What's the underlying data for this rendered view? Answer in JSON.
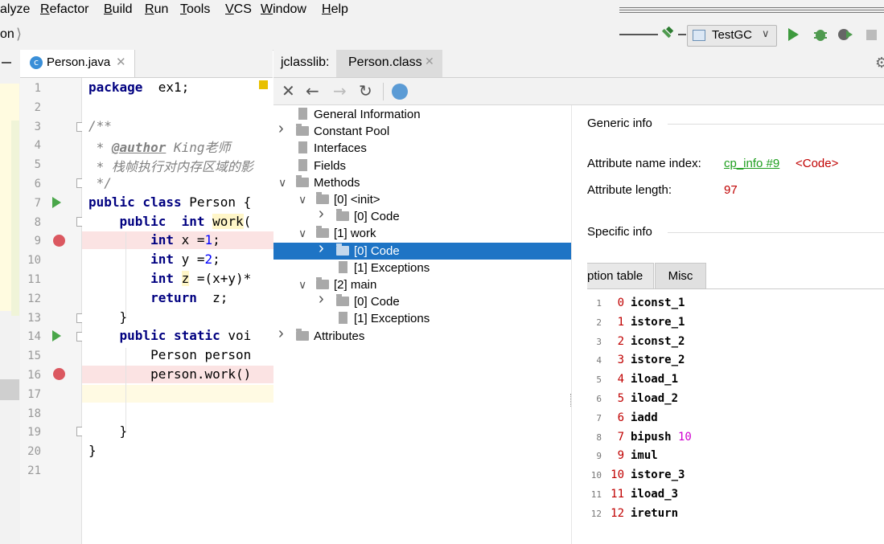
{
  "menu": {
    "items": [
      "alyze",
      "Refactor",
      "Build",
      "Run",
      "Tools",
      "VCS",
      "Window",
      "Help"
    ]
  },
  "navbar": {
    "breadcrumb": "on",
    "run_config": "TestGC"
  },
  "editor": {
    "tab_label": "Person.java",
    "line_numbers": [
      "1",
      "2",
      "3",
      "4",
      "5",
      "6",
      "7",
      "8",
      "9",
      "10",
      "11",
      "12",
      "13",
      "14",
      "15",
      "16",
      "17",
      "18",
      "19",
      "20",
      "21"
    ],
    "lines": [
      {
        "kw": "package",
        "rest": " ex1;"
      },
      {
        "kw": "",
        "rest": ""
      },
      {
        "kw": "",
        "rest": "/**"
      },
      {
        "kw": "",
        "rest": " * ",
        "tag": "@author",
        "tail": " King老师"
      },
      {
        "kw": "",
        "rest": " * 栈帧执行对内存区域的影"
      },
      {
        "kw": "",
        "rest": " */"
      },
      {
        "kw": "public class",
        "rest": " Person {"
      },
      {
        "kw": "    public",
        "kw2": "  int",
        "rest2": " work("
      },
      {
        "kw": "        int",
        "rest": " x =",
        "num": "1",
        ";": ";"
      },
      {
        "kw": "        int",
        "rest": " y =",
        "num": "2",
        ";": ";"
      },
      {
        "kw": "        int",
        "rest": " z =(x+y)*"
      },
      {
        "kw": "        return",
        "rest": "  z;"
      },
      {
        "kw": "",
        "rest": "    }"
      },
      {
        "kw": "    public static",
        "rest": " voi"
      },
      {
        "kw": "",
        "rest": "        Person person"
      },
      {
        "kw": "",
        "rest": "        person.work()"
      },
      {
        "kw": "",
        "rest": ""
      },
      {
        "kw": "",
        "rest": ""
      },
      {
        "kw": "",
        "rest": "    }"
      },
      {
        "kw": "",
        "rest": "}"
      },
      {
        "kw": "",
        "rest": ""
      }
    ]
  },
  "jclasslib": {
    "prefix": "jclasslib:",
    "tab_label": "Person.class",
    "tree": [
      {
        "label": "General Information",
        "indent": 0,
        "kind": "file",
        "chev": ""
      },
      {
        "label": "Constant Pool",
        "indent": 0,
        "kind": "folder",
        "chev": ">"
      },
      {
        "label": "Interfaces",
        "indent": 0,
        "kind": "file",
        "chev": ""
      },
      {
        "label": "Fields",
        "indent": 0,
        "kind": "file",
        "chev": ""
      },
      {
        "label": "Methods",
        "indent": 0,
        "kind": "folder",
        "chev": "v"
      },
      {
        "label": "[0] <init>",
        "indent": 1,
        "kind": "folder",
        "chev": "v"
      },
      {
        "label": "[0] Code",
        "indent": 2,
        "kind": "folder",
        "chev": ">"
      },
      {
        "label": "[1] work",
        "indent": 1,
        "kind": "folder",
        "chev": "v"
      },
      {
        "label": "[0] Code",
        "indent": 2,
        "kind": "folder",
        "chev": ">",
        "selected": true
      },
      {
        "label": "[1] Exceptions",
        "indent": 2,
        "kind": "file",
        "chev": ""
      },
      {
        "label": "[2] main",
        "indent": 1,
        "kind": "folder",
        "chev": "v"
      },
      {
        "label": "[0] Code",
        "indent": 2,
        "kind": "folder",
        "chev": ">"
      },
      {
        "label": "[1] Exceptions",
        "indent": 2,
        "kind": "file",
        "chev": ""
      },
      {
        "label": "Attributes",
        "indent": 0,
        "kind": "folder",
        "chev": ">"
      }
    ],
    "generic_info_title": "Generic info",
    "attr_name_index_label": "Attribute name index:",
    "attr_name_index_link": "cp_info #9",
    "attr_name_index_value": "<Code>",
    "attr_length_label": "Attribute length:",
    "attr_length_value": "97",
    "specific_info_title": "Specific info",
    "bytecode_tabs": [
      "ption table",
      "Misc"
    ],
    "bytecode": [
      {
        "ln": "1",
        "off": "0",
        "op": "iconst_1",
        "arg": ""
      },
      {
        "ln": "2",
        "off": "1",
        "op": "istore_1",
        "arg": ""
      },
      {
        "ln": "3",
        "off": "2",
        "op": "iconst_2",
        "arg": ""
      },
      {
        "ln": "4",
        "off": "3",
        "op": "istore_2",
        "arg": ""
      },
      {
        "ln": "5",
        "off": "4",
        "op": "iload_1",
        "arg": ""
      },
      {
        "ln": "6",
        "off": "5",
        "op": "iload_2",
        "arg": ""
      },
      {
        "ln": "7",
        "off": "6",
        "op": "iadd",
        "arg": ""
      },
      {
        "ln": "8",
        "off": "7",
        "op": "bipush",
        "arg": "10"
      },
      {
        "ln": "9",
        "off": "9",
        "op": "imul",
        "arg": ""
      },
      {
        "ln": "10",
        "off": "10",
        "op": "istore_3",
        "arg": ""
      },
      {
        "ln": "11",
        "off": "11",
        "op": "iload_3",
        "arg": ""
      },
      {
        "ln": "12",
        "off": "12",
        "op": "ireturn",
        "arg": ""
      }
    ]
  }
}
